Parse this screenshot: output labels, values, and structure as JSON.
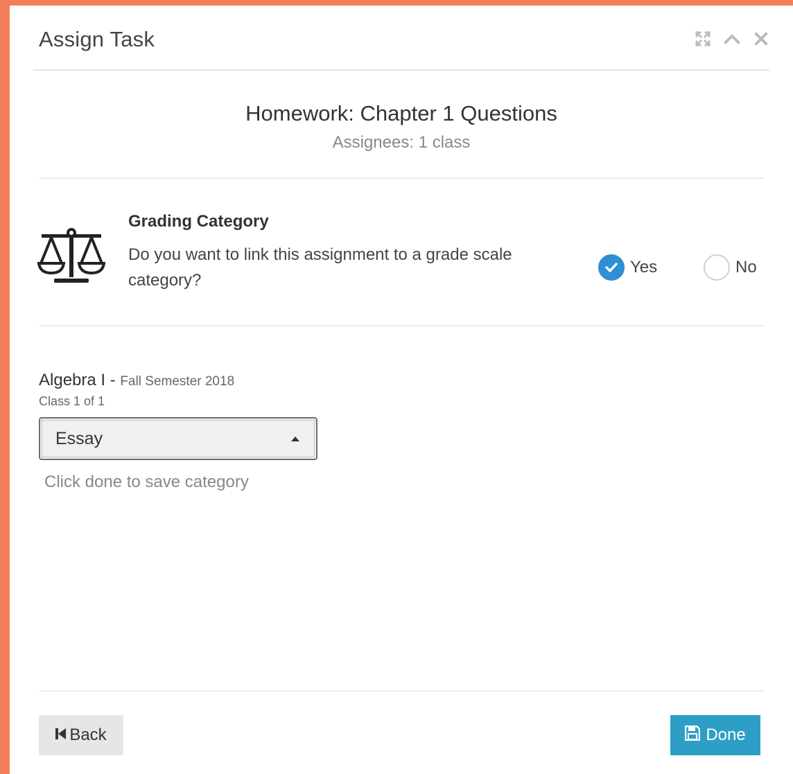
{
  "colors": {
    "frame": "#f47f5b",
    "radio_checked": "#2e8fd4",
    "done_button": "#2d9fc7"
  },
  "dialog": {
    "title": "Assign Task",
    "controls": [
      {
        "name": "expand",
        "icon": "expand-icon"
      },
      {
        "name": "collapse",
        "icon": "chevron-up-icon"
      },
      {
        "name": "close",
        "icon": "close-icon"
      }
    ]
  },
  "task": {
    "heading": "Homework: Chapter 1 Questions",
    "assignees": "Assignees: 1 class"
  },
  "grading": {
    "icon": "balance-scale-icon",
    "title": "Grading Category",
    "question": "Do you want to link this assignment to a grade scale category?",
    "options": {
      "yes": {
        "label": "Yes",
        "selected": true
      },
      "no": {
        "label": "No",
        "selected": false
      }
    }
  },
  "class_info": {
    "name": "Algebra I - ",
    "semester": "Fall Semester 2018",
    "count": "Class 1 of 1"
  },
  "category_select": {
    "value": "Essay"
  },
  "hint": "Click done to save category",
  "footer": {
    "back_label": "Back",
    "back_icon": "step-backward-icon",
    "done_label": "Done",
    "done_icon": "save-icon"
  }
}
